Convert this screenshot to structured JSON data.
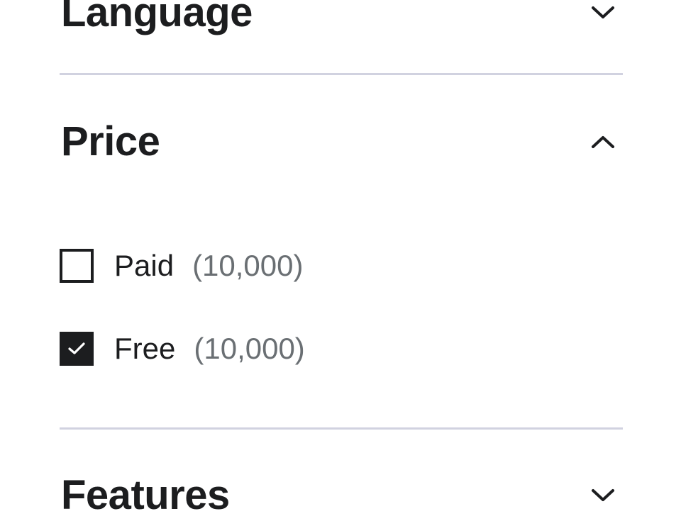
{
  "filters": {
    "language": {
      "title": "Language",
      "expanded": false,
      "icon": "chevron-down-icon"
    },
    "price": {
      "title": "Price",
      "expanded": true,
      "icon": "chevron-up-icon",
      "options": [
        {
          "label": "Paid",
          "count": "(10,000)",
          "checked": false
        },
        {
          "label": "Free",
          "count": "(10,000)",
          "checked": true
        }
      ]
    },
    "features": {
      "title": "Features",
      "expanded": false,
      "icon": "chevron-down-icon"
    }
  },
  "colors": {
    "text": "#1c1d1f",
    "count": "#6a6f73",
    "divider": "#d1d2e0",
    "checkbox_checked": "#1c1d1f"
  }
}
